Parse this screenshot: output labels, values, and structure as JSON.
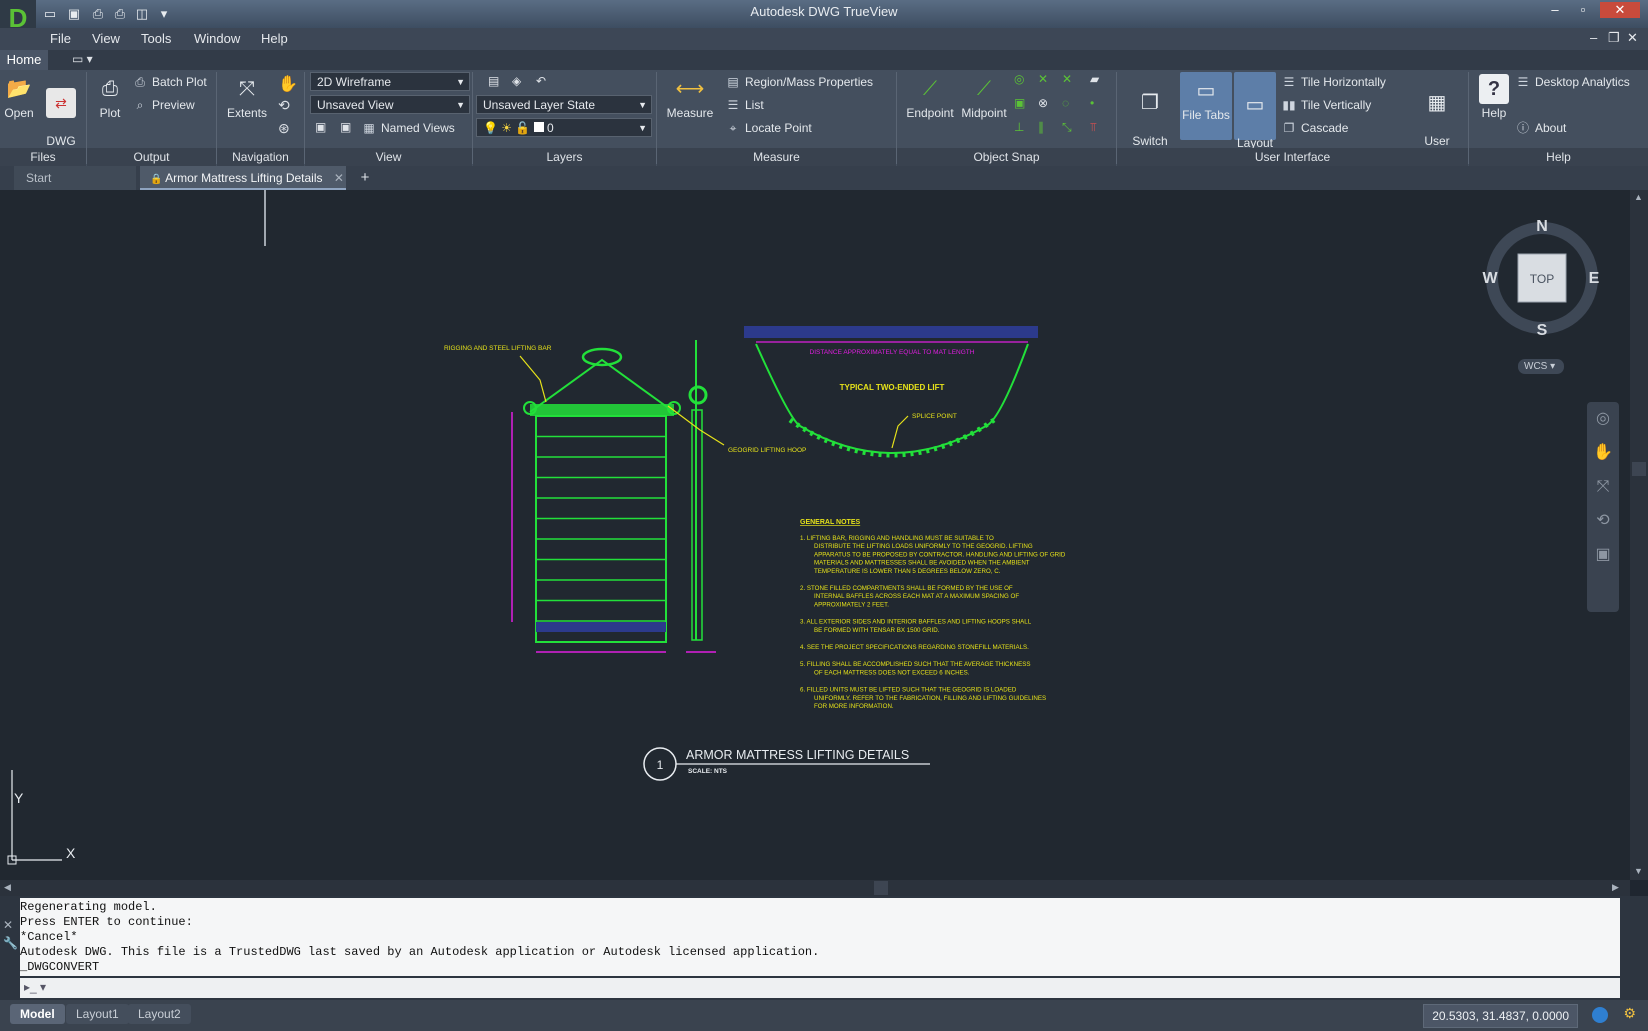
{
  "app": {
    "logo": "D",
    "title": "Autodesk DWG TrueView"
  },
  "menu": [
    "File",
    "View",
    "Tools",
    "Window",
    "Help"
  ],
  "ribbon_tab": "Home",
  "ribbon": {
    "files": {
      "title": "Files",
      "open": "Open",
      "dwg_convert": "DWG\nConvert"
    },
    "output": {
      "title": "Output",
      "plot": "Plot",
      "batch_plot": "Batch Plot",
      "preview": "Preview"
    },
    "navigation": {
      "title": "Navigation",
      "extents": "Extents"
    },
    "view": {
      "title": "View",
      "visual_style": "2D Wireframe",
      "named_view": "Unsaved View",
      "named_views": "Named Views"
    },
    "layers": {
      "title": "Layers",
      "layer_state": "Unsaved Layer State",
      "current_layer": "0"
    },
    "measure": {
      "title": "Measure",
      "measure": "Measure",
      "region": "Region/Mass Properties",
      "list": "List",
      "locate": "Locate Point"
    },
    "osnap": {
      "title": "Object Snap",
      "endpoint": "Endpoint",
      "midpoint": "Midpoint"
    },
    "ui": {
      "title": "User Interface",
      "switch_windows": "Switch\nWindows",
      "file_tabs": "File Tabs",
      "layout_tabs": "Layout\nTabs",
      "tile_h": "Tile Horizontally",
      "tile_v": "Tile Vertically",
      "cascade": "Cascade",
      "user_interface": "User\nInterface"
    },
    "help": {
      "title": "Help",
      "help": "Help",
      "desktop_analytics": "Desktop Analytics",
      "about": "About"
    }
  },
  "doc_tabs": {
    "start": "Start",
    "active": "Armor Mattress Lifting Details",
    "add": "+"
  },
  "viewcube": {
    "n": "N",
    "s": "S",
    "e": "E",
    "w": "W",
    "face": "TOP",
    "wcs": "WCS"
  },
  "ucs": {
    "y": "Y",
    "x": "X"
  },
  "drawing": {
    "rigging_label": "RIGGING AND STEEL LIFTING BAR",
    "hoop_label": "GEOGRID LIFTING HOOP",
    "distance_label": "DISTANCE APPROXIMATELY EQUAL TO MAT LENGTH",
    "lift_title": "TYPICAL TWO-ENDED LIFT",
    "splice_label": "SPLICE POINT",
    "notes_title": "GENERAL NOTES",
    "notes": [
      "1.   LIFTING BAR, RIGGING AND HANDLING MUST BE SUITABLE TO DISTRIBUTE THE LIFTING LOADS UNIFORMLY TO THE GEOGRID. LIFTING APPARATUS TO BE PROPOSED BY CONTRACTOR. HANDLING AND LIFTING OF GRID MATERIALS AND MATTRESSES SHALL BE AVOIDED WHEN THE AMBIENT TEMPERATURE IS LOWER THAN 5 DEGREES BELOW ZERO, C.",
      "2.   STONE FILLED COMPARTMENTS SHALL BE FORMED BY THE USE OF INTERNAL BAFFLES ACROSS EACH MAT AT A MAXIMUM SPACING OF APPROXIMATELY 2 FEET.",
      "3.   ALL EXTERIOR SIDES AND INTERIOR BAFFLES AND LIFTING HOOPS SHALL BE FORMED WITH TENSAR BX 1500 GRID.",
      "4.   SEE THE PROJECT SPECIFICATIONS REGARDING STONEFILL MATERIALS.",
      "5.   FILLING SHALL BE ACCOMPLISHED SUCH THAT THE AVERAGE THICKNESS OF EACH MATTRESS DOES NOT EXCEED 6 INCHES.",
      "6.   FILLED UNITS MUST BE LIFTED SUCH THAT THE GEOGRID IS LOADED UNIFORMLY. REFER TO THE FABRICATION, FILLING AND LIFTING GUIDELINES FOR MORE INFORMATION."
    ],
    "detail_number": "1",
    "detail_title": "ARMOR MATTRESS LIFTING DETAILS",
    "detail_scale": "SCALE: NTS"
  },
  "command_history": [
    "Regenerating model.",
    "Press ENTER to continue:",
    "*Cancel*",
    "Autodesk DWG.  This file is a TrustedDWG last saved by an Autodesk application or Autodesk licensed application.",
    "_DWGCONVERT"
  ],
  "layout_tabs": [
    "Model",
    "Layout1",
    "Layout2"
  ],
  "coordinates": "20.5303, 31.4837, 0.0000",
  "colors": {
    "drawing_bg": "#212830",
    "green": "#22e03a",
    "yellow": "#e6e21a",
    "magenta": "#e01ee0",
    "blue_bar": "#2c3a8c"
  }
}
